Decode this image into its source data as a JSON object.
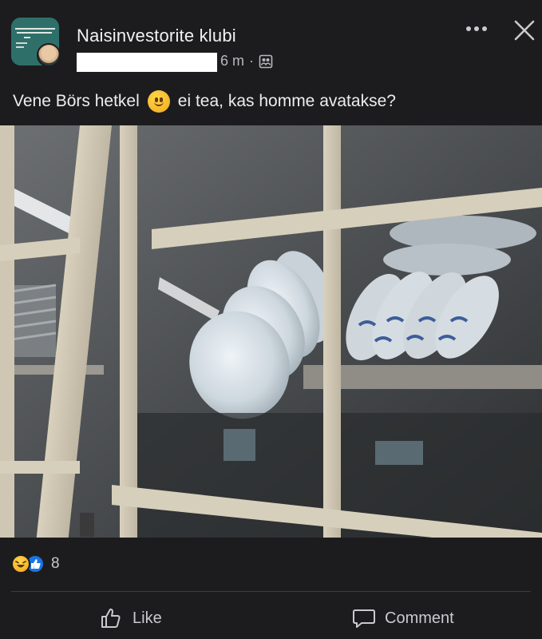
{
  "post": {
    "group_name": "Naisinvestorite klubi",
    "time": "6 m",
    "separator": "·",
    "text_before": "Vene Börs hetkel",
    "text_after": "ei tea, kas homme avatakse?",
    "group_avatar_text": "MAN'S BEST PROTECTION IS A MONEY OF HER OWN"
  },
  "reactions": {
    "count": "8",
    "types": [
      "haha-icon",
      "like-icon"
    ]
  },
  "actions": {
    "like_label": "Like",
    "comment_label": "Comment"
  },
  "colors": {
    "background": "#1c1c1e",
    "text": "#e8e8ea",
    "meta": "#b7b8bc",
    "like_blue": "#1b74e4"
  }
}
